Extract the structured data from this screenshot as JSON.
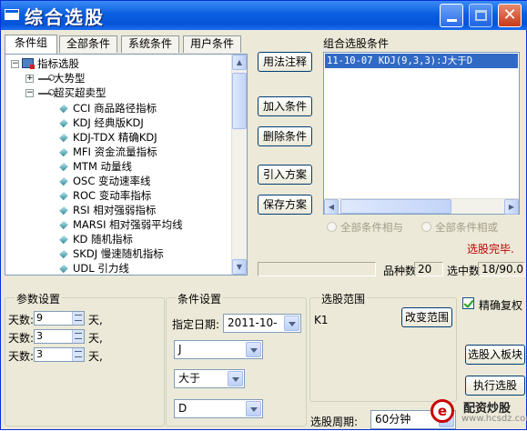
{
  "window": {
    "title": "综合选股"
  },
  "tabs": [
    "条件组",
    "全部条件",
    "系统条件",
    "用户条件"
  ],
  "tree": {
    "root": "指标选股",
    "groups": [
      "大势型",
      "超买超卖型"
    ],
    "items": [
      "CCI 商品路径指标",
      "KDJ 经典版KDJ",
      "KDJ-TDX 精确KDJ",
      "MFI 资金流量指标",
      "MTM 动量线",
      "OSC 变动速率线",
      "ROC 变动率指标",
      "RSI 相对强弱指标",
      "MARSI 相对强弱平均线",
      "KD 随机指标",
      "SKDJ 慢速随机指标",
      "UDL 引力线"
    ]
  },
  "buttons": {
    "usage": "用法注释",
    "add": "加入条件",
    "delete": "删除条件",
    "import": "引入方案",
    "save": "保存方案",
    "change_range": "改变范围",
    "to_block": "选股入板块",
    "execute": "执行选股"
  },
  "combo": {
    "title": "组合选股条件",
    "items": [
      "11-10-07 KDJ(9,3,3):J大于D"
    ]
  },
  "options": {
    "and": "全部条件相与",
    "or": "全部条件相或"
  },
  "status": {
    "done": "选股完毕.",
    "count_label": "品种数",
    "count_value": "20",
    "selected_label": "选中数",
    "selected_value": "18/90.0"
  },
  "params": {
    "title": "参数设置",
    "rows": [
      {
        "label": "天数:",
        "value": "9",
        "unit": "天,"
      },
      {
        "label": "天数:",
        "value": "3",
        "unit": "天,"
      },
      {
        "label": "天数:",
        "value": "3",
        "unit": "天,"
      }
    ]
  },
  "condition": {
    "title": "条件设置",
    "date_label": "指定日期:",
    "date_value": "2011-10-",
    "left": "J",
    "op": "大于",
    "right": "D"
  },
  "range": {
    "title": "选股范围",
    "value": "K1"
  },
  "precise": {
    "label": "精确复权"
  },
  "period": {
    "label": "选股周期:",
    "value": "60分钟"
  },
  "watermark": {
    "logo": "e",
    "name": "配资炒股",
    "url": "www.hcsdz.com"
  }
}
